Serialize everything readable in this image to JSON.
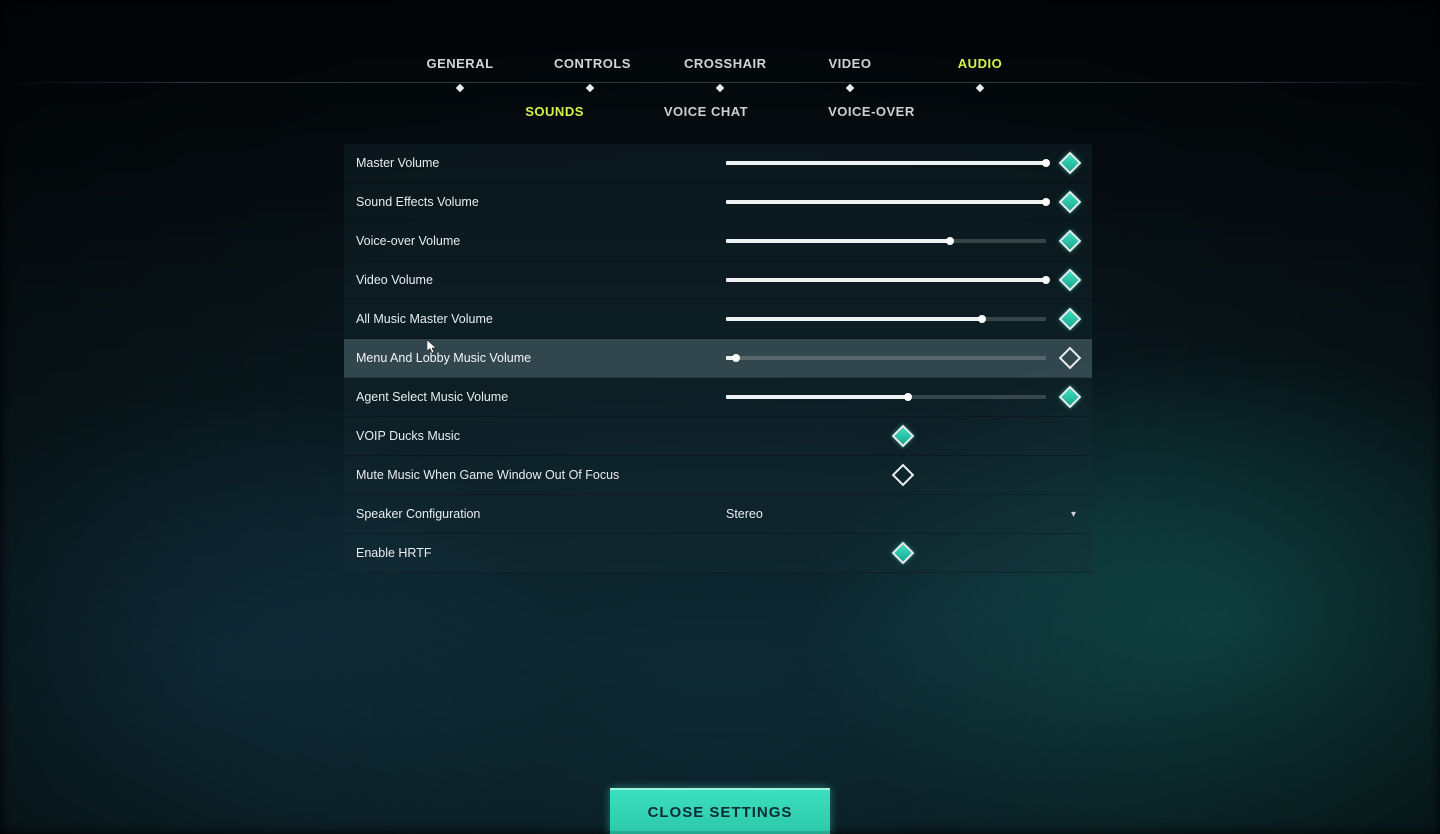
{
  "tabs": {
    "items": [
      {
        "label": "GENERAL",
        "active": false
      },
      {
        "label": "CONTROLS",
        "active": false
      },
      {
        "label": "CROSSHAIR",
        "active": false
      },
      {
        "label": "VIDEO",
        "active": false
      },
      {
        "label": "AUDIO",
        "active": true
      }
    ]
  },
  "subtabs": {
    "items": [
      {
        "label": "SOUNDS",
        "active": true
      },
      {
        "label": "VOICE CHAT",
        "active": false
      },
      {
        "label": "VOICE-OVER",
        "active": false
      }
    ]
  },
  "settings": {
    "rows": [
      {
        "type": "slider",
        "label": "Master Volume",
        "value": 100,
        "reset_on": true,
        "hover": false
      },
      {
        "type": "slider",
        "label": "Sound Effects Volume",
        "value": 100,
        "reset_on": true,
        "hover": false
      },
      {
        "type": "slider",
        "label": "Voice-over Volume",
        "value": 70,
        "reset_on": true,
        "hover": false
      },
      {
        "type": "slider",
        "label": "Video Volume",
        "value": 100,
        "reset_on": true,
        "hover": false
      },
      {
        "type": "slider",
        "label": "All Music Master Volume",
        "value": 80,
        "reset_on": true,
        "hover": false
      },
      {
        "type": "slider",
        "label": "Menu And Lobby Music Volume",
        "value": 3,
        "reset_on": false,
        "hover": true
      },
      {
        "type": "slider",
        "label": "Agent Select Music Volume",
        "value": 57,
        "reset_on": true,
        "hover": false
      },
      {
        "type": "check",
        "label": "VOIP Ducks Music",
        "checked": true,
        "hover": false
      },
      {
        "type": "check",
        "label": "Mute Music When Game Window Out Of Focus",
        "checked": false,
        "hover": false
      },
      {
        "type": "dropdown",
        "label": "Speaker Configuration",
        "value": "Stereo",
        "hover": false
      },
      {
        "type": "check",
        "label": "Enable HRTF",
        "checked": true,
        "hover": false
      }
    ]
  },
  "close_label": "CLOSE SETTINGS",
  "colors": {
    "accent": "#3be0c0",
    "highlight": "#d4f24a"
  }
}
